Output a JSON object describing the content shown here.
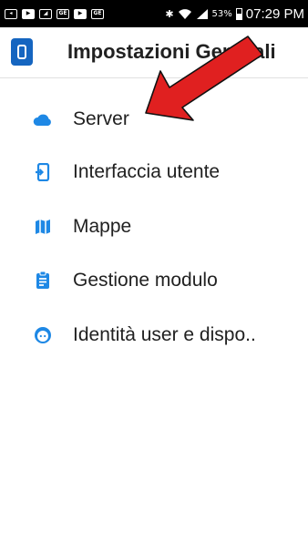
{
  "status_bar": {
    "left_icons": [
      "notification-icon",
      "youtube-icon",
      "image-icon",
      "gallery-icon",
      "youtube-icon",
      "gallery-icon"
    ],
    "battery_percent": "53%",
    "time": "07:29 PM"
  },
  "app_bar": {
    "title": "Impostazioni Generali",
    "logo_icon": "app-logo-icon"
  },
  "menu": {
    "items": [
      {
        "label": "Server",
        "icon": "cloud-icon"
      },
      {
        "label": "Interfaccia utente",
        "icon": "phone-icon"
      },
      {
        "label": "Mappe",
        "icon": "map-icon"
      },
      {
        "label": "Gestione modulo",
        "icon": "clipboard-icon"
      },
      {
        "label": "Identità user e dispo..",
        "icon": "face-icon"
      }
    ]
  },
  "colors": {
    "accent": "#1e88e5",
    "annotation_arrow": "#e02020",
    "text": "#212121"
  }
}
